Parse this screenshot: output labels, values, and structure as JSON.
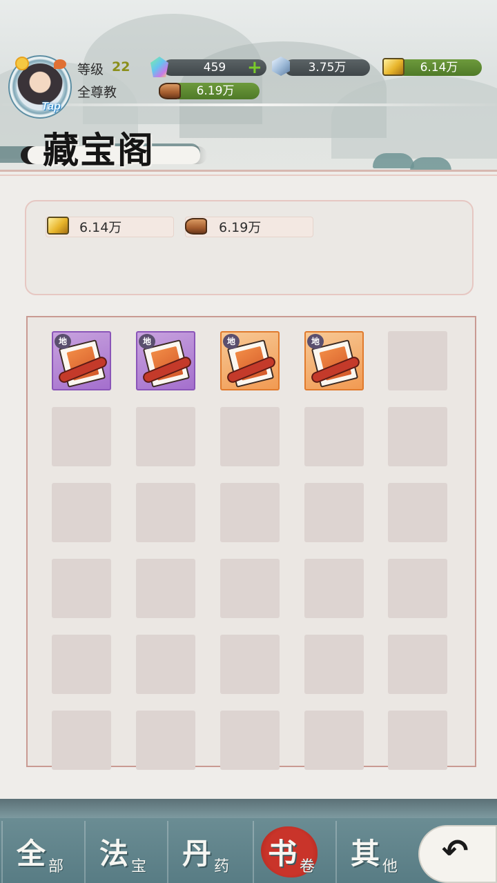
{
  "player": {
    "level_label": "等级",
    "level": "22",
    "sect": "全尊教",
    "tap": "Tap"
  },
  "resources": {
    "gem": {
      "value": "459",
      "icon": "gem-icon"
    },
    "crystal": {
      "value": "3.75万",
      "icon": "crystal-icon"
    },
    "gold": {
      "value": "6.14万",
      "icon": "gold-ingot-icon"
    },
    "wood": {
      "value": "6.19万",
      "icon": "wood-log-icon"
    }
  },
  "page": {
    "title": "藏宝阁"
  },
  "summary": {
    "gold": "6.14万",
    "wood": "6.19万"
  },
  "inventory": {
    "items": [
      {
        "name": "scroll-book",
        "rarity": "purple",
        "tag": "地"
      },
      {
        "name": "scroll-book",
        "rarity": "purple",
        "tag": "地"
      },
      {
        "name": "scroll-book",
        "rarity": "orange",
        "tag": "地"
      },
      {
        "name": "scroll-book",
        "rarity": "orange",
        "tag": "地"
      }
    ],
    "colors": {
      "purple": "#a46fcd",
      "orange": "#f19a52"
    }
  },
  "tabs": [
    {
      "big": "全",
      "small": "部",
      "active": false
    },
    {
      "big": "法",
      "small": "宝",
      "active": false
    },
    {
      "big": "丹",
      "small": "药",
      "active": false
    },
    {
      "big": "书",
      "small": "卷",
      "active": true
    },
    {
      "big": "其",
      "small": "他",
      "active": false
    }
  ],
  "back_icon": "back-arrow-icon",
  "accent": {
    "active_tab": "#c9342a",
    "bar_green": "#6d9a3c"
  }
}
